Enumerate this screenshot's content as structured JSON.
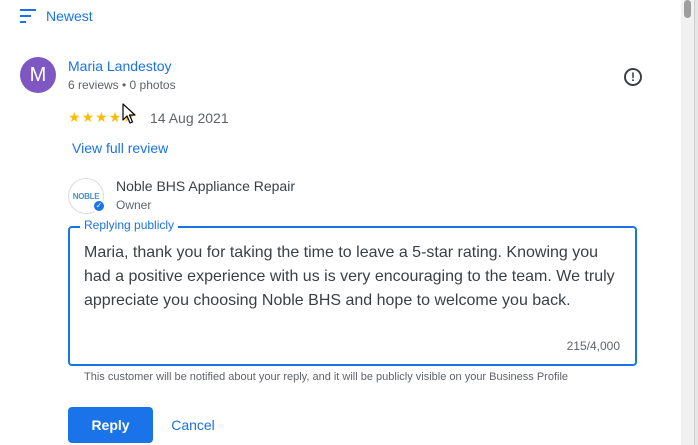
{
  "sort": {
    "label": "Newest",
    "icon": "sort-icon"
  },
  "review": {
    "avatar_letter": "M",
    "avatar_color": "#7e57c2",
    "reviewer_name": "Maria Landestoy",
    "reviewer_meta": "6 reviews • 0 photos",
    "rating": 5,
    "date": "14 Aug 2021",
    "view_full_label": "View full review",
    "report_icon": "report-icon"
  },
  "owner": {
    "logo_text": "NOBLE",
    "name": "Noble BHS Appliance Repair",
    "role": "Owner",
    "verified_icon": "verified-icon"
  },
  "reply": {
    "legend": "Replying publicly",
    "text": "Maria, thank you for taking the time to leave a 5-star rating. Knowing you had a positive experience with us is very encouraging to the team. We truly appreciate you choosing Noble BHS and hope to welcome you back.",
    "char_count": "215/4,000",
    "notice": "This customer will be notified about your reply, and it will be publicly visible on your Business Profile",
    "reply_label": "Reply",
    "cancel_label": "Cancel"
  },
  "colors": {
    "accent": "#1a73e8",
    "star": "#fbbc04"
  }
}
